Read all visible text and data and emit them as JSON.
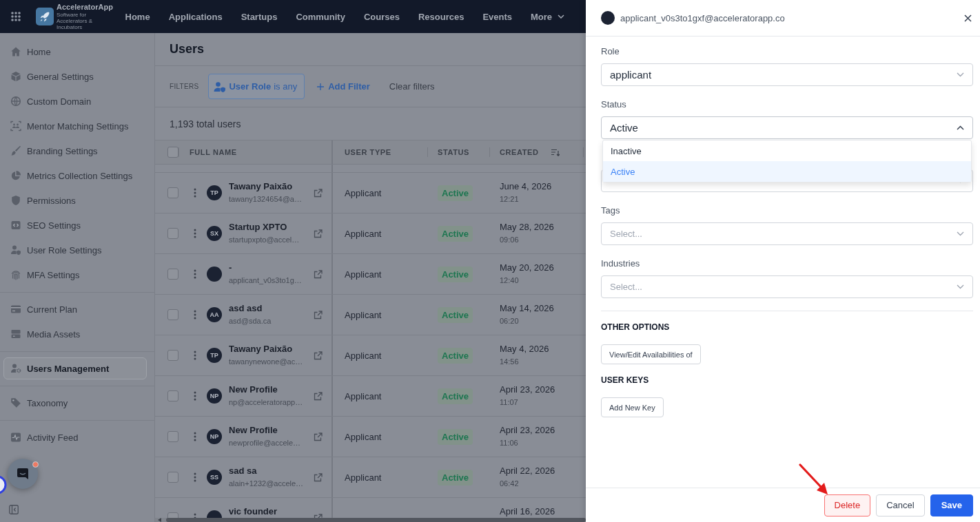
{
  "top_nav": {
    "logo": {
      "name": "AcceleratorApp",
      "tagline": "Software for Accelerators & Incubators"
    },
    "items": [
      {
        "label": "Home",
        "kind": "link"
      },
      {
        "label": "Applications",
        "kind": "link"
      },
      {
        "label": "Startups",
        "kind": "link"
      },
      {
        "label": "Community",
        "kind": "link"
      },
      {
        "label": "Courses",
        "kind": "link"
      },
      {
        "label": "Resources",
        "kind": "link"
      },
      {
        "label": "Events",
        "kind": "link"
      },
      {
        "label": "More",
        "kind": "dropdown"
      }
    ]
  },
  "sidebar": {
    "groups": [
      {
        "items": [
          {
            "label": "Home",
            "selected": false
          },
          {
            "label": "General Settings",
            "selected": false
          },
          {
            "label": "Custom Domain",
            "selected": false
          },
          {
            "label": "Mentor Matching Settings",
            "selected": false
          },
          {
            "label": "Branding Settings",
            "selected": false
          },
          {
            "label": "Metrics Collection Settings",
            "selected": false
          },
          {
            "label": "Permissions",
            "selected": false
          },
          {
            "label": "SEO Settings",
            "selected": false
          },
          {
            "label": "User Role Settings",
            "selected": false
          },
          {
            "label": "MFA Settings",
            "selected": false
          }
        ]
      },
      {
        "items": [
          {
            "label": "Current Plan",
            "selected": false
          },
          {
            "label": "Media Assets",
            "selected": false
          }
        ]
      },
      {
        "items": [
          {
            "label": "Users Management",
            "selected": true
          }
        ]
      },
      {
        "items": [
          {
            "label": "Taxonomy",
            "selected": false
          }
        ]
      },
      {
        "items": [
          {
            "label": "Activity Feed",
            "selected": false
          }
        ]
      }
    ]
  },
  "users_page": {
    "title": "Users",
    "filters": {
      "label": "FILTERS",
      "chips": [
        "**User Role** is any"
      ],
      "add_filter": "Add Filter",
      "clear_filters": "Clear filters"
    },
    "total": "1,193 total users",
    "table": {
      "select_all": {
        "checked": false
      },
      "columns": [
        {
          "label": "FULL NAME",
          "sorted": false
        },
        {
          "label": "USER TYPE",
          "sorted": false
        },
        {
          "label": "STATUS",
          "sorted": false
        },
        {
          "label": "CREATED",
          "sorted": true
        }
      ],
      "rows": [
        {
          "checked": false,
          "initials": "TP",
          "name": "Tawany Paixão",
          "email": "tawany1324654@a…",
          "user_type": "Applicant",
          "status": "Active",
          "created_date": "June 4, 2026",
          "created_time": "12:21"
        },
        {
          "checked": false,
          "initials": "SX",
          "name": "Startup XPTO",
          "email": "startupxpto@accel…",
          "user_type": "Applicant",
          "status": "Active",
          "created_date": "May 28, 2026",
          "created_time": "09:06"
        },
        {
          "checked": false,
          "name": "-",
          "email": "applicant_v0s3to1g…",
          "user_type": "Applicant",
          "status": "Active",
          "created_date": "May 20, 2026",
          "created_time": "12:40"
        },
        {
          "checked": false,
          "initials": "AA",
          "name": "asd asd",
          "email": "asd@sda.ca",
          "user_type": "Applicant",
          "status": "Active",
          "created_date": "May 14, 2026",
          "created_time": "06:20"
        },
        {
          "checked": false,
          "initials": "TP",
          "name": "Tawany Paixão",
          "email": "tawanynewone@ac…",
          "user_type": "Applicant",
          "status": "Active",
          "created_date": "May 4, 2026",
          "created_time": "14:56"
        },
        {
          "checked": false,
          "initials": "NP",
          "name": "New Profile",
          "email": "np@acceleratorapp…",
          "user_type": "Applicant",
          "status": "Active",
          "created_date": "April 23, 2026",
          "created_time": "11:07"
        },
        {
          "checked": false,
          "initials": "NP",
          "name": "New Profile",
          "email": "newprofile@accele…",
          "user_type": "Applicant",
          "status": "Active",
          "created_date": "April 23, 2026",
          "created_time": "11:06"
        },
        {
          "checked": false,
          "initials": "SS",
          "name": "sad sa",
          "email": "alain+1232@accele…",
          "user_type": "Applicant",
          "status": "Active",
          "created_date": "April 22, 2026",
          "created_time": "06:42"
        },
        {
          "checked": false,
          "name": "vic founder",
          "created_date": "April 16, 2026"
        }
      ]
    }
  },
  "drawer": {
    "email": "applicant_v0s3to1gxf@acceleratorapp.co",
    "fields": [
      {
        "label": "Role",
        "value": "applicant",
        "open": false
      },
      {
        "label": "Status",
        "value": "Active",
        "open": true,
        "options": [
          {
            "label": "Inactive",
            "selected": false
          },
          {
            "label": "Active",
            "selected": true
          }
        ]
      },
      {
        "open": false
      },
      {
        "label": "Tags",
        "placeholder": "Select...",
        "open": false
      },
      {
        "label": "Industries",
        "placeholder": "Select...",
        "open": false
      }
    ],
    "sections": [
      {
        "title": "OTHER OPTIONS",
        "buttons": [
          "View/Edit Availabilities of"
        ]
      },
      {
        "title": "USER KEYS",
        "buttons": [
          "Add New Key"
        ]
      }
    ],
    "footer_buttons": [
      {
        "label": "Delete",
        "kind": "danger"
      },
      {
        "label": "Cancel",
        "kind": "secondary"
      },
      {
        "label": "Save",
        "kind": "primary"
      }
    ]
  }
}
